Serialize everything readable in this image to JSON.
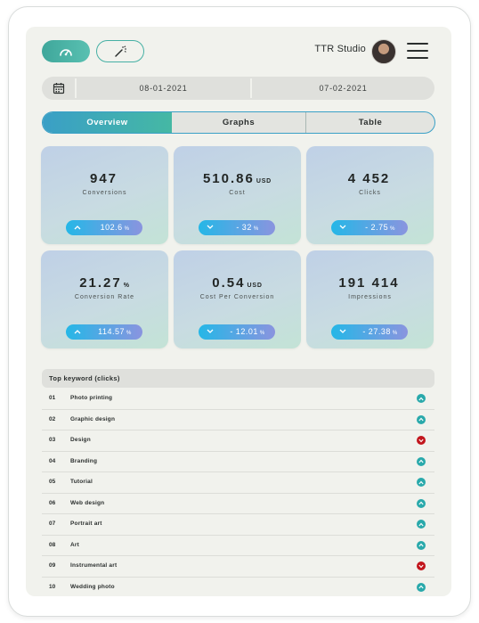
{
  "header": {
    "studio_name": "TTR Studio",
    "speed_icon": "speedometer-icon",
    "wand_icon": "magic-wand-icon",
    "menu_icon": "hamburger-menu-icon"
  },
  "date_range": {
    "calendar_icon": "calendar-icon",
    "start": "08-01-2021",
    "end": "07-02-2021"
  },
  "tabs": [
    {
      "label": "Overview",
      "active": true
    },
    {
      "label": "Graphs",
      "active": false
    },
    {
      "label": "Table",
      "active": false
    }
  ],
  "metrics": [
    {
      "value": "947",
      "unit": "",
      "label": "Conversions",
      "change": "102.6",
      "change_unit": "%",
      "direction": "up"
    },
    {
      "value": "510.86",
      "unit": "USD",
      "label": "Cost",
      "change": "- 32",
      "change_unit": "%",
      "direction": "down"
    },
    {
      "value": "4 452",
      "unit": "",
      "label": "Clicks",
      "change": "- 2.75",
      "change_unit": "%",
      "direction": "down"
    },
    {
      "value": "21.27",
      "unit": "%",
      "label": "Conversion Rate",
      "change": "114.57",
      "change_unit": "%",
      "direction": "up"
    },
    {
      "value": "0.54",
      "unit": "USD",
      "label": "Cost Per Conversion",
      "change": "- 12.01",
      "change_unit": "%",
      "direction": "down"
    },
    {
      "value": "191 414",
      "unit": "",
      "label": "Impressions",
      "change": "- 27.38",
      "change_unit": "%",
      "direction": "down"
    }
  ],
  "keywords": {
    "title": "Top keyword (clicks)",
    "rows": [
      {
        "rank": "01",
        "name": "Photo printing",
        "trend": "up"
      },
      {
        "rank": "02",
        "name": "Graphic design",
        "trend": "up"
      },
      {
        "rank": "03",
        "name": "Design",
        "trend": "down"
      },
      {
        "rank": "04",
        "name": "Branding",
        "trend": "up"
      },
      {
        "rank": "05",
        "name": "Tutorial",
        "trend": "up"
      },
      {
        "rank": "06",
        "name": "Web design",
        "trend": "up"
      },
      {
        "rank": "07",
        "name": "Portrait art",
        "trend": "up"
      },
      {
        "rank": "08",
        "name": "Art",
        "trend": "up"
      },
      {
        "rank": "09",
        "name": "Instrumental art",
        "trend": "down"
      },
      {
        "rank": "10",
        "name": "Wedding photo",
        "trend": "up"
      }
    ]
  },
  "colors": {
    "accent_teal": "#46b0a4",
    "accent_blue": "#3a9fc6",
    "trend_up": "#29a9ab",
    "trend_down": "#c2161d",
    "screen_bg": "#f1f2ed"
  }
}
